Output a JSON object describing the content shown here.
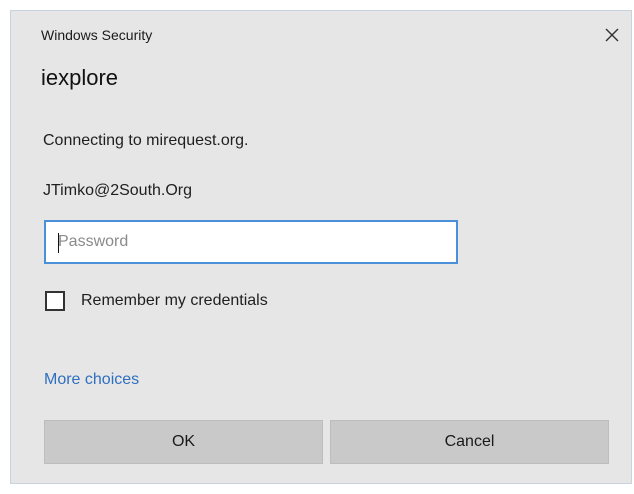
{
  "dialog": {
    "window_title": "Windows Security",
    "app_title": "iexplore",
    "message": "Connecting to mirequest.org.",
    "username": "JTimko@2South.Org",
    "password": {
      "placeholder": "Password",
      "value": ""
    },
    "remember": {
      "label": "Remember my credentials",
      "checked": false
    },
    "more_choices_label": "More choices",
    "ok_label": "OK",
    "cancel_label": "Cancel"
  },
  "colors": {
    "background": "#e6e6e6",
    "input_border_focus": "#4a90d9",
    "link": "#2f6fbf",
    "button": "#c9c9c9"
  },
  "icons": {
    "close": "close-icon"
  }
}
